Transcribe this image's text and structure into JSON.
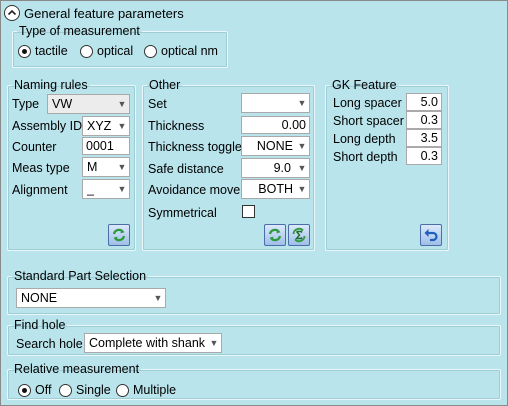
{
  "header": {
    "title": "General feature parameters"
  },
  "type_of_measurement": {
    "legend": "Type of measurement",
    "options": [
      {
        "label": "tactile",
        "selected": true
      },
      {
        "label": "optical",
        "selected": false
      },
      {
        "label": "optical nm",
        "selected": false
      }
    ]
  },
  "naming_rules": {
    "legend": "Naming rules",
    "type_label": "Type",
    "type_value": "VW",
    "assembly_label": "Assembly ID",
    "assembly_value": "XYZ",
    "counter_label": "Counter",
    "counter_value": "0001",
    "meas_type_label": "Meas type",
    "meas_type_value": "M",
    "alignment_label": "Alignment",
    "alignment_value": "_",
    "refresh_icon": "refresh-icon"
  },
  "other": {
    "legend": "Other",
    "set_label": "Set",
    "set_value": "",
    "thickness_label": "Thickness",
    "thickness_value": "0.00",
    "thickness_toggle_label": "Thickness toggle",
    "thickness_toggle_value": "NONE",
    "safe_distance_label": "Safe distance",
    "safe_distance_value": "9.0",
    "avoidance_move_label": "Avoidance move",
    "avoidance_move_value": "BOTH",
    "symmetrical_label": "Symmetrical",
    "symmetrical_checked": false
  },
  "gk_feature": {
    "legend": "GK Feature",
    "long_spacer_label": "Long spacer",
    "long_spacer_value": "5.0",
    "short_spacer_label": "Short spacer",
    "short_spacer_value": "0.3",
    "long_depth_label": "Long depth",
    "long_depth_value": "3.5",
    "short_depth_label": "Short depth",
    "short_depth_value": "0.3"
  },
  "standard_part": {
    "legend": "Standard Part Selection",
    "value": "NONE"
  },
  "find_hole": {
    "legend": "Find hole",
    "search_label": "Search hole",
    "search_value": "Complete with shank"
  },
  "relative_measurement": {
    "legend": "Relative measurement",
    "options": [
      {
        "label": "Off",
        "selected": true
      },
      {
        "label": "Single",
        "selected": false
      },
      {
        "label": "Multiple",
        "selected": false
      }
    ]
  },
  "colors": {
    "background": "#b9e4ec",
    "button_blue": "#9fbfe8",
    "refresh_green": "#2e9a3c",
    "undo_blue": "#1f5fb8"
  }
}
